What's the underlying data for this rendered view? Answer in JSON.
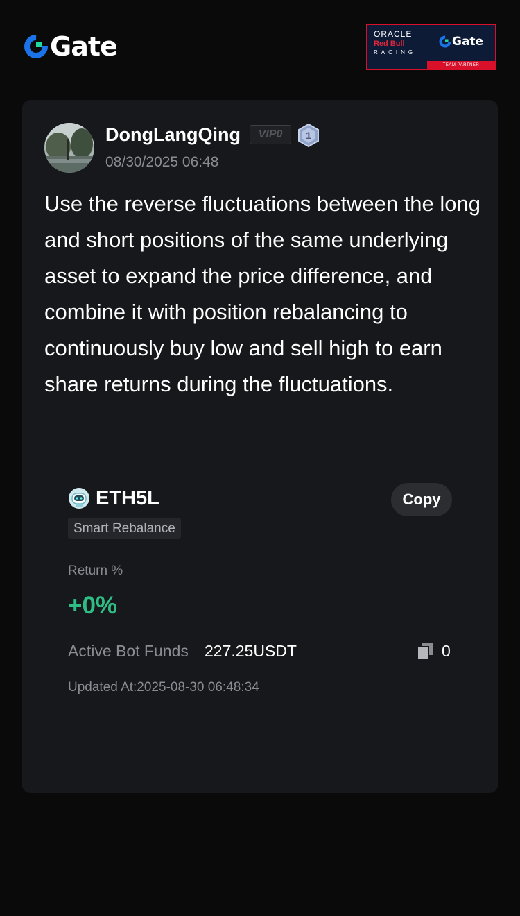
{
  "header": {
    "logo_text": "Gate",
    "partner": {
      "oracle": "ORACLE",
      "redbull": "Red Bull",
      "racing": "RACING",
      "gate": "Gate",
      "team_partner": "TEAM PARTNER"
    }
  },
  "post": {
    "author": {
      "username": "DongLangQing",
      "vip_label": "VIP0",
      "level": "1"
    },
    "timestamp": "08/30/2025 06:48",
    "text": "Use the reverse fluctuations between the long and short positions of the same underlying asset to expand the price difference, and combine it with position rebalancing to continuously buy low and sell high to earn share returns during the fluctuations."
  },
  "bot": {
    "name": "ETH5L",
    "strategy_tag": "Smart Rebalance",
    "copy_label": "Copy",
    "return_label": "Return %",
    "return_value": "+0%",
    "funds_label": "Active Bot Funds",
    "funds_value": "227.25USDT",
    "copies_count": "0",
    "updated_at": "Updated At:2025-08-30 06:48:34"
  },
  "colors": {
    "brand_blue": "#1a73e8",
    "positive_green": "#2ebd85",
    "partner_red": "#d8102a"
  },
  "icons": {
    "logo": "gate-logo-icon",
    "level": "level-shield-icon",
    "bot": "robot-icon",
    "copies": "copies-icon"
  }
}
